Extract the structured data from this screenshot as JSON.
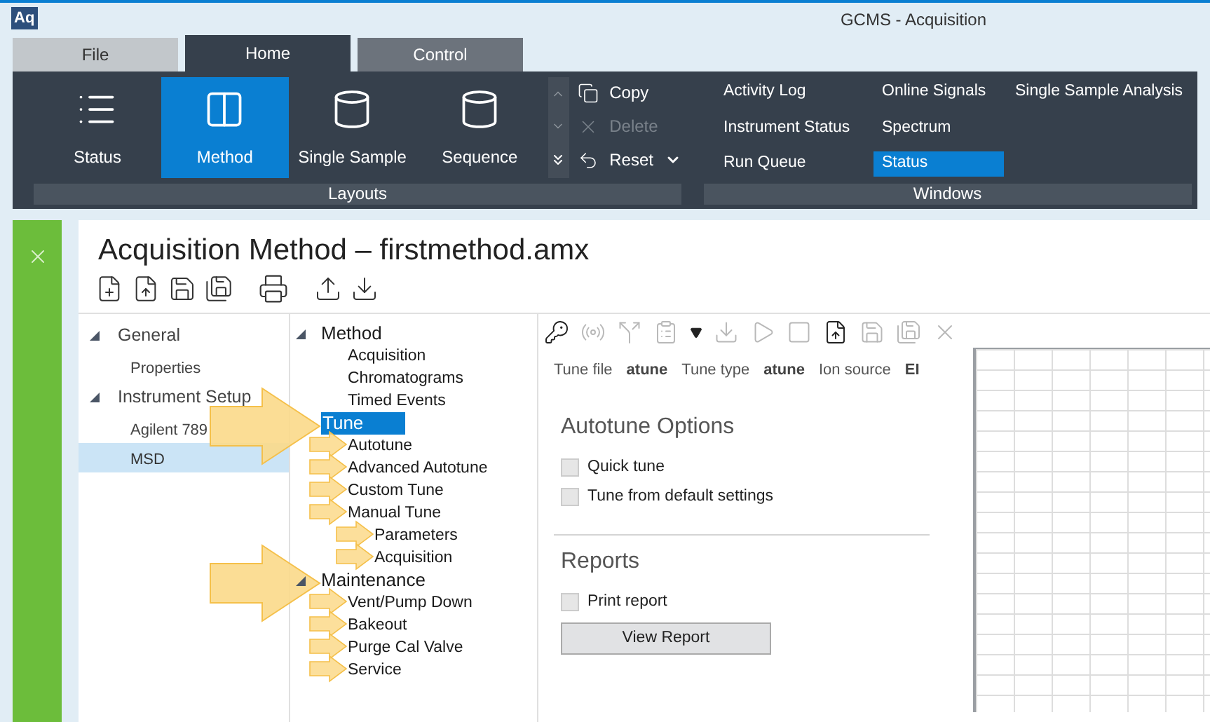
{
  "app": {
    "logo": "Aq",
    "title": "GCMS - Acquisition"
  },
  "ribbon_tabs": [
    {
      "label": "File",
      "selected": false
    },
    {
      "label": "Home",
      "selected": true
    },
    {
      "label": "Control",
      "selected": false
    }
  ],
  "layouts": {
    "label": "Layouts",
    "buttons": [
      {
        "label": "Status",
        "selected": false
      },
      {
        "label": "Method",
        "selected": true
      },
      {
        "label": "Single Sample",
        "selected": false
      },
      {
        "label": "Sequence",
        "selected": false
      }
    ]
  },
  "clipboard": [
    {
      "label": "Copy",
      "disabled": false,
      "kind": "plain"
    },
    {
      "label": "Delete",
      "disabled": true,
      "kind": "plain"
    },
    {
      "label": "Reset",
      "disabled": false,
      "kind": "dropdown"
    }
  ],
  "windows": {
    "label": "Windows",
    "items": [
      {
        "label": "Activity Log",
        "selected": false
      },
      {
        "label": "Instrument Status",
        "selected": false
      },
      {
        "label": "Run Queue",
        "selected": false
      },
      {
        "label": "Online Signals",
        "selected": false
      },
      {
        "label": "Spectrum",
        "selected": false
      },
      {
        "label": "Status",
        "selected": true
      },
      {
        "label": "Single Sample Analysis",
        "selected": false
      }
    ]
  },
  "document": {
    "title": "Acquisition Method – firstmethod.amx"
  },
  "left_tree": [
    {
      "label": "General",
      "expanded": true,
      "selected": false,
      "children": [
        {
          "label": "Properties",
          "selected": false
        }
      ]
    },
    {
      "label": "Instrument Setup",
      "expanded": true,
      "selected": false,
      "children": [
        {
          "label": "Agilent 789",
          "selected": false
        },
        {
          "label": "MSD",
          "selected": true
        }
      ]
    }
  ],
  "method_tree": [
    {
      "label": "Method",
      "expanded": true,
      "selected": false,
      "children": [
        {
          "label": "Acquisition",
          "selected": false
        },
        {
          "label": "Chromatograms",
          "selected": false
        },
        {
          "label": "Timed Events",
          "selected": false
        }
      ]
    },
    {
      "label": "Tune",
      "selected": true,
      "callout": true,
      "children": [
        {
          "label": "Autotune",
          "selected": false,
          "callout": true
        },
        {
          "label": "Advanced Autotune",
          "selected": false,
          "callout": true
        },
        {
          "label": "Custom Tune",
          "selected": false,
          "callout": true
        },
        {
          "label": "Manual Tune",
          "selected": false,
          "callout": true,
          "children": [
            {
              "label": "Parameters",
              "selected": false,
              "callout": true
            },
            {
              "label": "Acquisition",
              "selected": false,
              "callout": true
            }
          ]
        }
      ]
    },
    {
      "label": "Maintenance",
      "expanded": true,
      "selected": false,
      "callout": true,
      "children": [
        {
          "label": "Vent/Pump Down",
          "selected": false,
          "callout": true
        },
        {
          "label": "Bakeout",
          "selected": false,
          "callout": true
        },
        {
          "label": "Purge Cal Valve",
          "selected": false,
          "callout": true
        },
        {
          "label": "Service",
          "selected": false,
          "callout": true
        }
      ]
    }
  ],
  "tune_toolbar": [
    {
      "disabled": false
    },
    {
      "disabled": true
    },
    {
      "disabled": true
    },
    {
      "disabled": true
    },
    {
      "disabled": false
    },
    {
      "disabled": true
    },
    {
      "disabled": true
    },
    {
      "disabled": true
    },
    {
      "disabled": false
    },
    {
      "disabled": true
    },
    {
      "disabled": true
    },
    {
      "disabled": true
    }
  ],
  "tune_info": [
    {
      "label": "Tune file",
      "value": "atune"
    },
    {
      "label": "Tune type",
      "value": "atune"
    },
    {
      "label": "Ion source",
      "value": "EI"
    }
  ],
  "autotune": {
    "heading": "Autotune Options",
    "options": [
      {
        "label": "Quick tune",
        "checked": false
      },
      {
        "label": "Tune from default settings",
        "checked": false
      }
    ]
  },
  "reports": {
    "heading": "Reports",
    "options": [
      {
        "label": "Print report",
        "checked": false
      }
    ],
    "button": "View Report"
  }
}
